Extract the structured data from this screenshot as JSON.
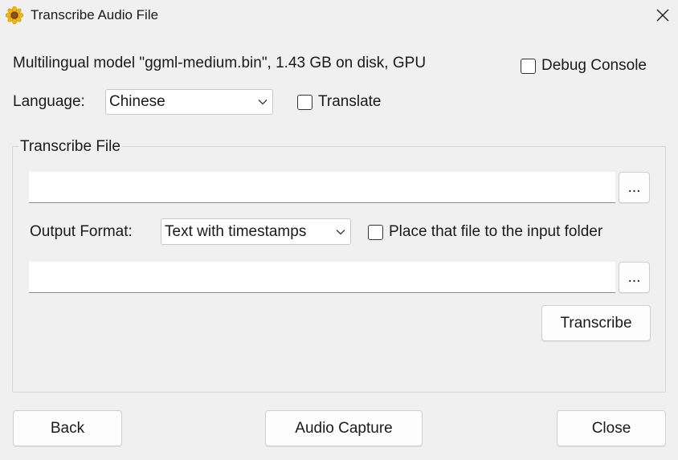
{
  "window": {
    "title": "Transcribe Audio File",
    "app_icon": "sunflower-icon",
    "close_icon": "close-icon"
  },
  "model_info": "Multilingual model \"ggml-medium.bin\", 1.43 GB on disk, GPU",
  "debug_console": {
    "label": "Debug Console",
    "checked": false
  },
  "language": {
    "label": "Language:",
    "value": "Chinese"
  },
  "translate": {
    "label": "Translate",
    "checked": false
  },
  "transcribe_group": {
    "title": "Transcribe File",
    "input_path": "",
    "browse_input_label": "...",
    "output_format": {
      "label": "Output Format:",
      "value": "Text with timestamps"
    },
    "place_in_input_folder": {
      "label": "Place that file to the input folder",
      "checked": false
    },
    "output_path": "",
    "browse_output_label": "...",
    "transcribe_button": "Transcribe"
  },
  "footer": {
    "back": "Back",
    "audio_capture": "Audio Capture",
    "close": "Close"
  },
  "colors": {
    "window_bg": "#f0f0f0",
    "field_bg": "#ffffff",
    "border": "#cfcfcf"
  }
}
